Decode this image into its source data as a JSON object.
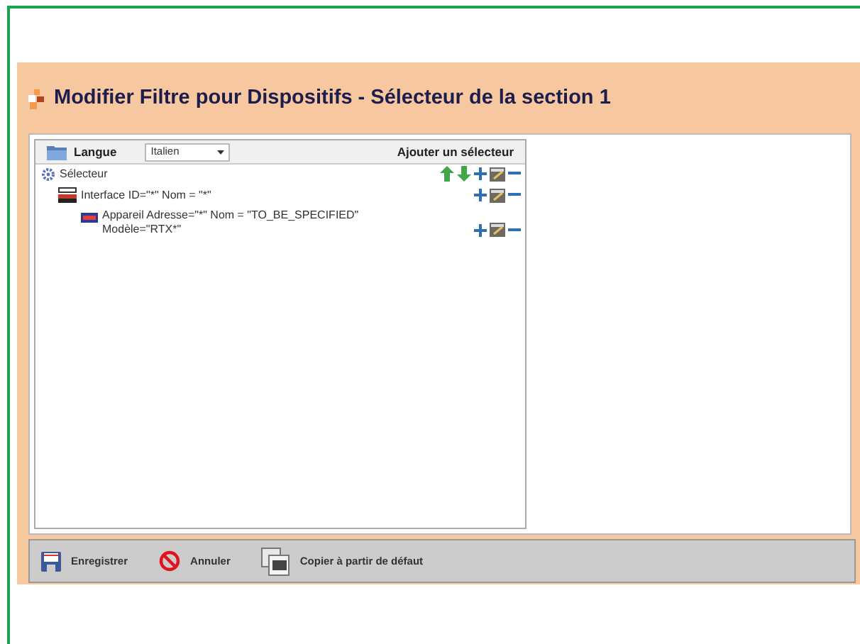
{
  "title": "Modifier Filtre pour Dispositifs - Sélecteur de la section 1",
  "toolbar": {
    "language_label": "Langue",
    "language_value": "Italien",
    "add_selector": "Ajouter un sélecteur"
  },
  "tree": [
    {
      "kind": "selector",
      "lines": [
        "Sélecteur"
      ],
      "movable": true,
      "children": [
        {
          "kind": "interface",
          "lines": [
            "Interface ID=\"*\" Nom = \"*\""
          ],
          "movable": false,
          "children": [
            {
              "kind": "device",
              "lines": [
                "Appareil Adresse=\"*\" Nom = \"TO_BE_SPECIFIED\"",
                "Modèle=\"RTX*\""
              ],
              "movable": false
            }
          ]
        }
      ]
    }
  ],
  "buttons": [
    {
      "kind": "save",
      "label": "Enregistrer"
    },
    {
      "kind": "cancel",
      "label": "Annuler"
    },
    {
      "kind": "copy",
      "label": "Copier à partir de défaut"
    }
  ]
}
